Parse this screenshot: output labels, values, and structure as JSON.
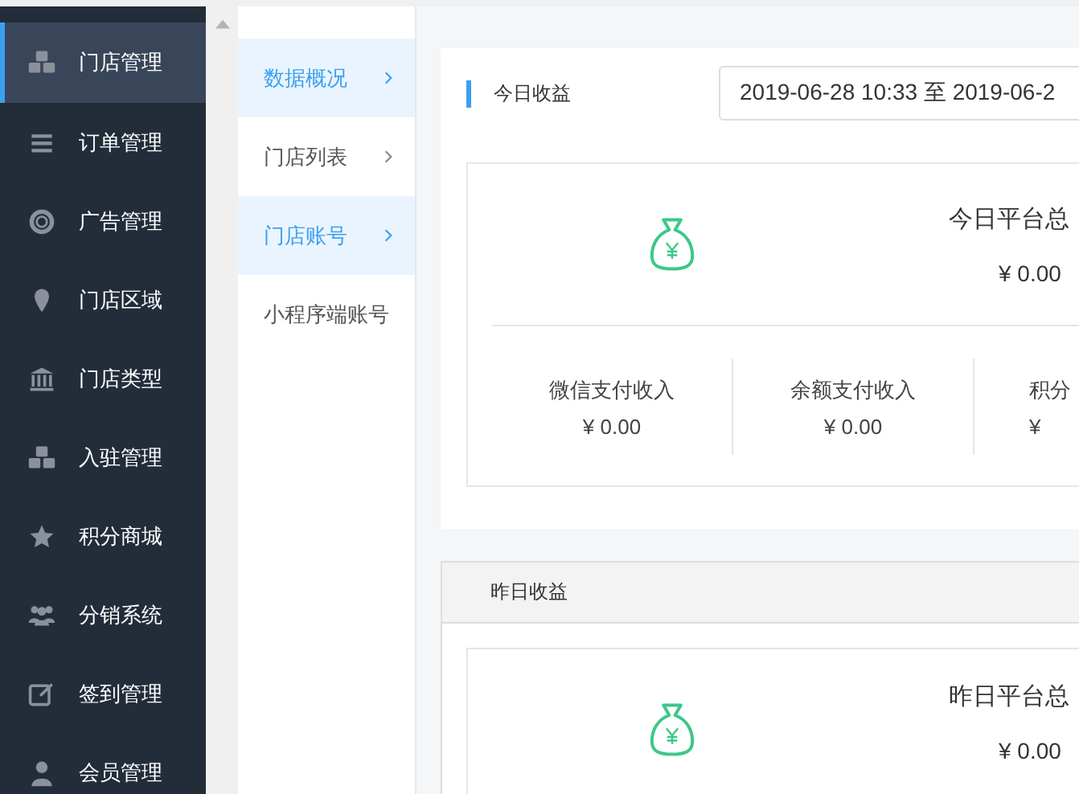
{
  "sidebar": {
    "items": [
      {
        "label": "门店管理",
        "selected": true
      },
      {
        "label": "订单管理",
        "selected": false
      },
      {
        "label": "广告管理",
        "selected": false
      },
      {
        "label": "门店区域",
        "selected": false
      },
      {
        "label": "门店类型",
        "selected": false
      },
      {
        "label": "入驻管理",
        "selected": false
      },
      {
        "label": "积分商城",
        "selected": false
      },
      {
        "label": "分销系统",
        "selected": false
      },
      {
        "label": "签到管理",
        "selected": false
      },
      {
        "label": "会员管理",
        "selected": false
      }
    ]
  },
  "submenu": {
    "items": [
      {
        "label": "数据概况",
        "selected": true,
        "arrow": true
      },
      {
        "label": "门店列表",
        "selected": false,
        "arrow": true
      },
      {
        "label": "门店账号",
        "selected": true,
        "arrow": true
      },
      {
        "label": "小程序端账号",
        "selected": false,
        "arrow": false
      }
    ]
  },
  "today": {
    "title": "今日收益",
    "date_range": "2019-06-28 10:33 至 2019-06-2",
    "total_label": "今日平台总",
    "total_value": "¥ 0.00",
    "stats": [
      {
        "label": "微信支付收入",
        "value": "¥ 0.00"
      },
      {
        "label": "余额支付收入",
        "value": "¥ 0.00"
      },
      {
        "label": "积分",
        "value": "¥"
      }
    ]
  },
  "yesterday": {
    "title": "昨日收益",
    "total_label": "昨日平台总",
    "total_value": "¥ 0.00"
  }
}
